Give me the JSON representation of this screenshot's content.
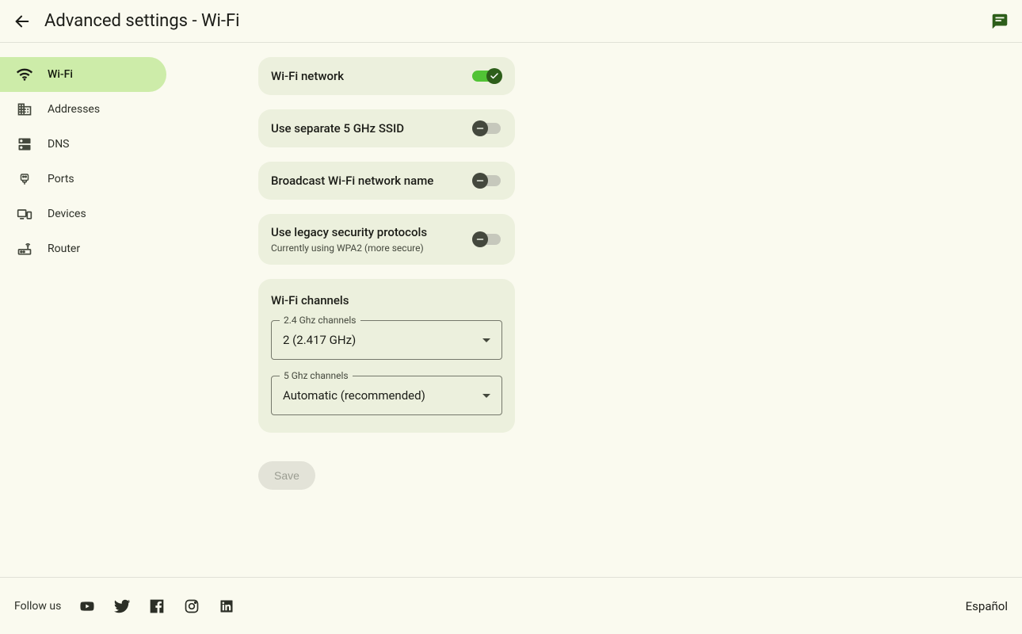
{
  "header": {
    "title": "Advanced settings - Wi-Fi"
  },
  "sidebar": {
    "items": [
      {
        "label": "Wi-Fi"
      },
      {
        "label": "Addresses"
      },
      {
        "label": "DNS"
      },
      {
        "label": "Ports"
      },
      {
        "label": "Devices"
      },
      {
        "label": "Router"
      }
    ]
  },
  "settings": {
    "wifi_network": {
      "label": "Wi-Fi network",
      "on": true
    },
    "separate_ssid": {
      "label": "Use separate 5 GHz SSID",
      "on": false
    },
    "broadcast_name": {
      "label": "Broadcast Wi-Fi network name",
      "on": false
    },
    "legacy_security": {
      "label": "Use legacy security protocols",
      "sub": "Currently using WPA2 (more secure)",
      "on": false
    },
    "channels": {
      "title": "Wi-Fi channels",
      "ch24": {
        "legend": "2.4 Ghz channels",
        "value": "2 (2.417 GHz)"
      },
      "ch5": {
        "legend": "5 Ghz channels",
        "value": "Automatic (recommended)"
      }
    },
    "save_label": "Save"
  },
  "footer": {
    "follow": "Follow us",
    "language": "Español"
  }
}
